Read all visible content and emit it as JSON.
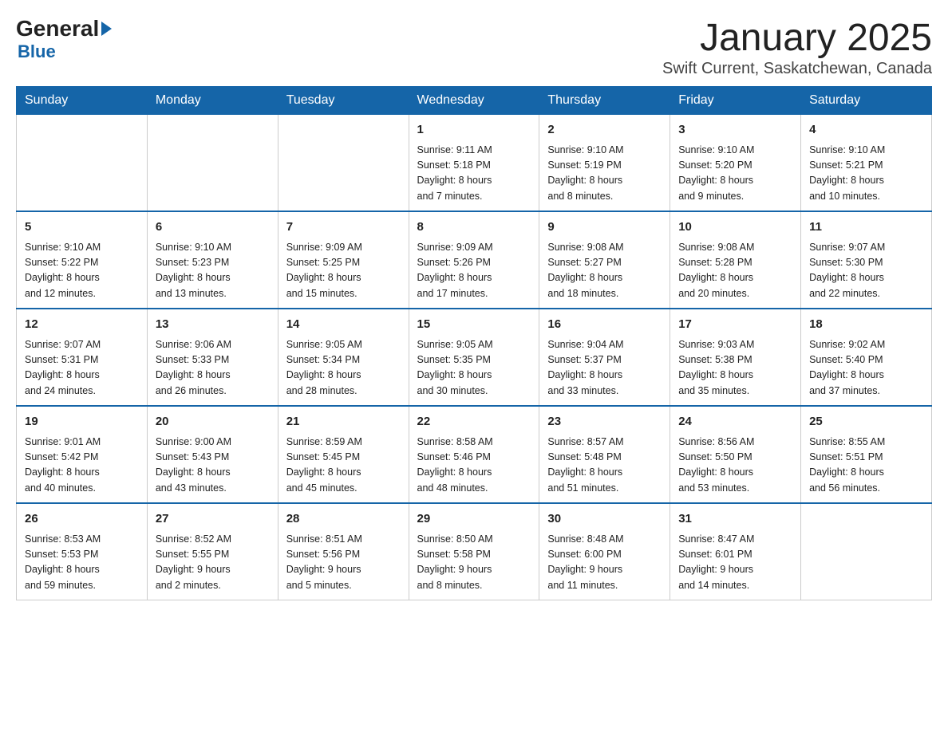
{
  "logo": {
    "general": "General",
    "blue": "Blue",
    "arrow": "▶"
  },
  "title": "January 2025",
  "subtitle": "Swift Current, Saskatchewan, Canada",
  "headers": [
    "Sunday",
    "Monday",
    "Tuesday",
    "Wednesday",
    "Thursday",
    "Friday",
    "Saturday"
  ],
  "weeks": [
    [
      {
        "day": "",
        "info": ""
      },
      {
        "day": "",
        "info": ""
      },
      {
        "day": "",
        "info": ""
      },
      {
        "day": "1",
        "info": "Sunrise: 9:11 AM\nSunset: 5:18 PM\nDaylight: 8 hours\nand 7 minutes."
      },
      {
        "day": "2",
        "info": "Sunrise: 9:10 AM\nSunset: 5:19 PM\nDaylight: 8 hours\nand 8 minutes."
      },
      {
        "day": "3",
        "info": "Sunrise: 9:10 AM\nSunset: 5:20 PM\nDaylight: 8 hours\nand 9 minutes."
      },
      {
        "day": "4",
        "info": "Sunrise: 9:10 AM\nSunset: 5:21 PM\nDaylight: 8 hours\nand 10 minutes."
      }
    ],
    [
      {
        "day": "5",
        "info": "Sunrise: 9:10 AM\nSunset: 5:22 PM\nDaylight: 8 hours\nand 12 minutes."
      },
      {
        "day": "6",
        "info": "Sunrise: 9:10 AM\nSunset: 5:23 PM\nDaylight: 8 hours\nand 13 minutes."
      },
      {
        "day": "7",
        "info": "Sunrise: 9:09 AM\nSunset: 5:25 PM\nDaylight: 8 hours\nand 15 minutes."
      },
      {
        "day": "8",
        "info": "Sunrise: 9:09 AM\nSunset: 5:26 PM\nDaylight: 8 hours\nand 17 minutes."
      },
      {
        "day": "9",
        "info": "Sunrise: 9:08 AM\nSunset: 5:27 PM\nDaylight: 8 hours\nand 18 minutes."
      },
      {
        "day": "10",
        "info": "Sunrise: 9:08 AM\nSunset: 5:28 PM\nDaylight: 8 hours\nand 20 minutes."
      },
      {
        "day": "11",
        "info": "Sunrise: 9:07 AM\nSunset: 5:30 PM\nDaylight: 8 hours\nand 22 minutes."
      }
    ],
    [
      {
        "day": "12",
        "info": "Sunrise: 9:07 AM\nSunset: 5:31 PM\nDaylight: 8 hours\nand 24 minutes."
      },
      {
        "day": "13",
        "info": "Sunrise: 9:06 AM\nSunset: 5:33 PM\nDaylight: 8 hours\nand 26 minutes."
      },
      {
        "day": "14",
        "info": "Sunrise: 9:05 AM\nSunset: 5:34 PM\nDaylight: 8 hours\nand 28 minutes."
      },
      {
        "day": "15",
        "info": "Sunrise: 9:05 AM\nSunset: 5:35 PM\nDaylight: 8 hours\nand 30 minutes."
      },
      {
        "day": "16",
        "info": "Sunrise: 9:04 AM\nSunset: 5:37 PM\nDaylight: 8 hours\nand 33 minutes."
      },
      {
        "day": "17",
        "info": "Sunrise: 9:03 AM\nSunset: 5:38 PM\nDaylight: 8 hours\nand 35 minutes."
      },
      {
        "day": "18",
        "info": "Sunrise: 9:02 AM\nSunset: 5:40 PM\nDaylight: 8 hours\nand 37 minutes."
      }
    ],
    [
      {
        "day": "19",
        "info": "Sunrise: 9:01 AM\nSunset: 5:42 PM\nDaylight: 8 hours\nand 40 minutes."
      },
      {
        "day": "20",
        "info": "Sunrise: 9:00 AM\nSunset: 5:43 PM\nDaylight: 8 hours\nand 43 minutes."
      },
      {
        "day": "21",
        "info": "Sunrise: 8:59 AM\nSunset: 5:45 PM\nDaylight: 8 hours\nand 45 minutes."
      },
      {
        "day": "22",
        "info": "Sunrise: 8:58 AM\nSunset: 5:46 PM\nDaylight: 8 hours\nand 48 minutes."
      },
      {
        "day": "23",
        "info": "Sunrise: 8:57 AM\nSunset: 5:48 PM\nDaylight: 8 hours\nand 51 minutes."
      },
      {
        "day": "24",
        "info": "Sunrise: 8:56 AM\nSunset: 5:50 PM\nDaylight: 8 hours\nand 53 minutes."
      },
      {
        "day": "25",
        "info": "Sunrise: 8:55 AM\nSunset: 5:51 PM\nDaylight: 8 hours\nand 56 minutes."
      }
    ],
    [
      {
        "day": "26",
        "info": "Sunrise: 8:53 AM\nSunset: 5:53 PM\nDaylight: 8 hours\nand 59 minutes."
      },
      {
        "day": "27",
        "info": "Sunrise: 8:52 AM\nSunset: 5:55 PM\nDaylight: 9 hours\nand 2 minutes."
      },
      {
        "day": "28",
        "info": "Sunrise: 8:51 AM\nSunset: 5:56 PM\nDaylight: 9 hours\nand 5 minutes."
      },
      {
        "day": "29",
        "info": "Sunrise: 8:50 AM\nSunset: 5:58 PM\nDaylight: 9 hours\nand 8 minutes."
      },
      {
        "day": "30",
        "info": "Sunrise: 8:48 AM\nSunset: 6:00 PM\nDaylight: 9 hours\nand 11 minutes."
      },
      {
        "day": "31",
        "info": "Sunrise: 8:47 AM\nSunset: 6:01 PM\nDaylight: 9 hours\nand 14 minutes."
      },
      {
        "day": "",
        "info": ""
      }
    ]
  ]
}
